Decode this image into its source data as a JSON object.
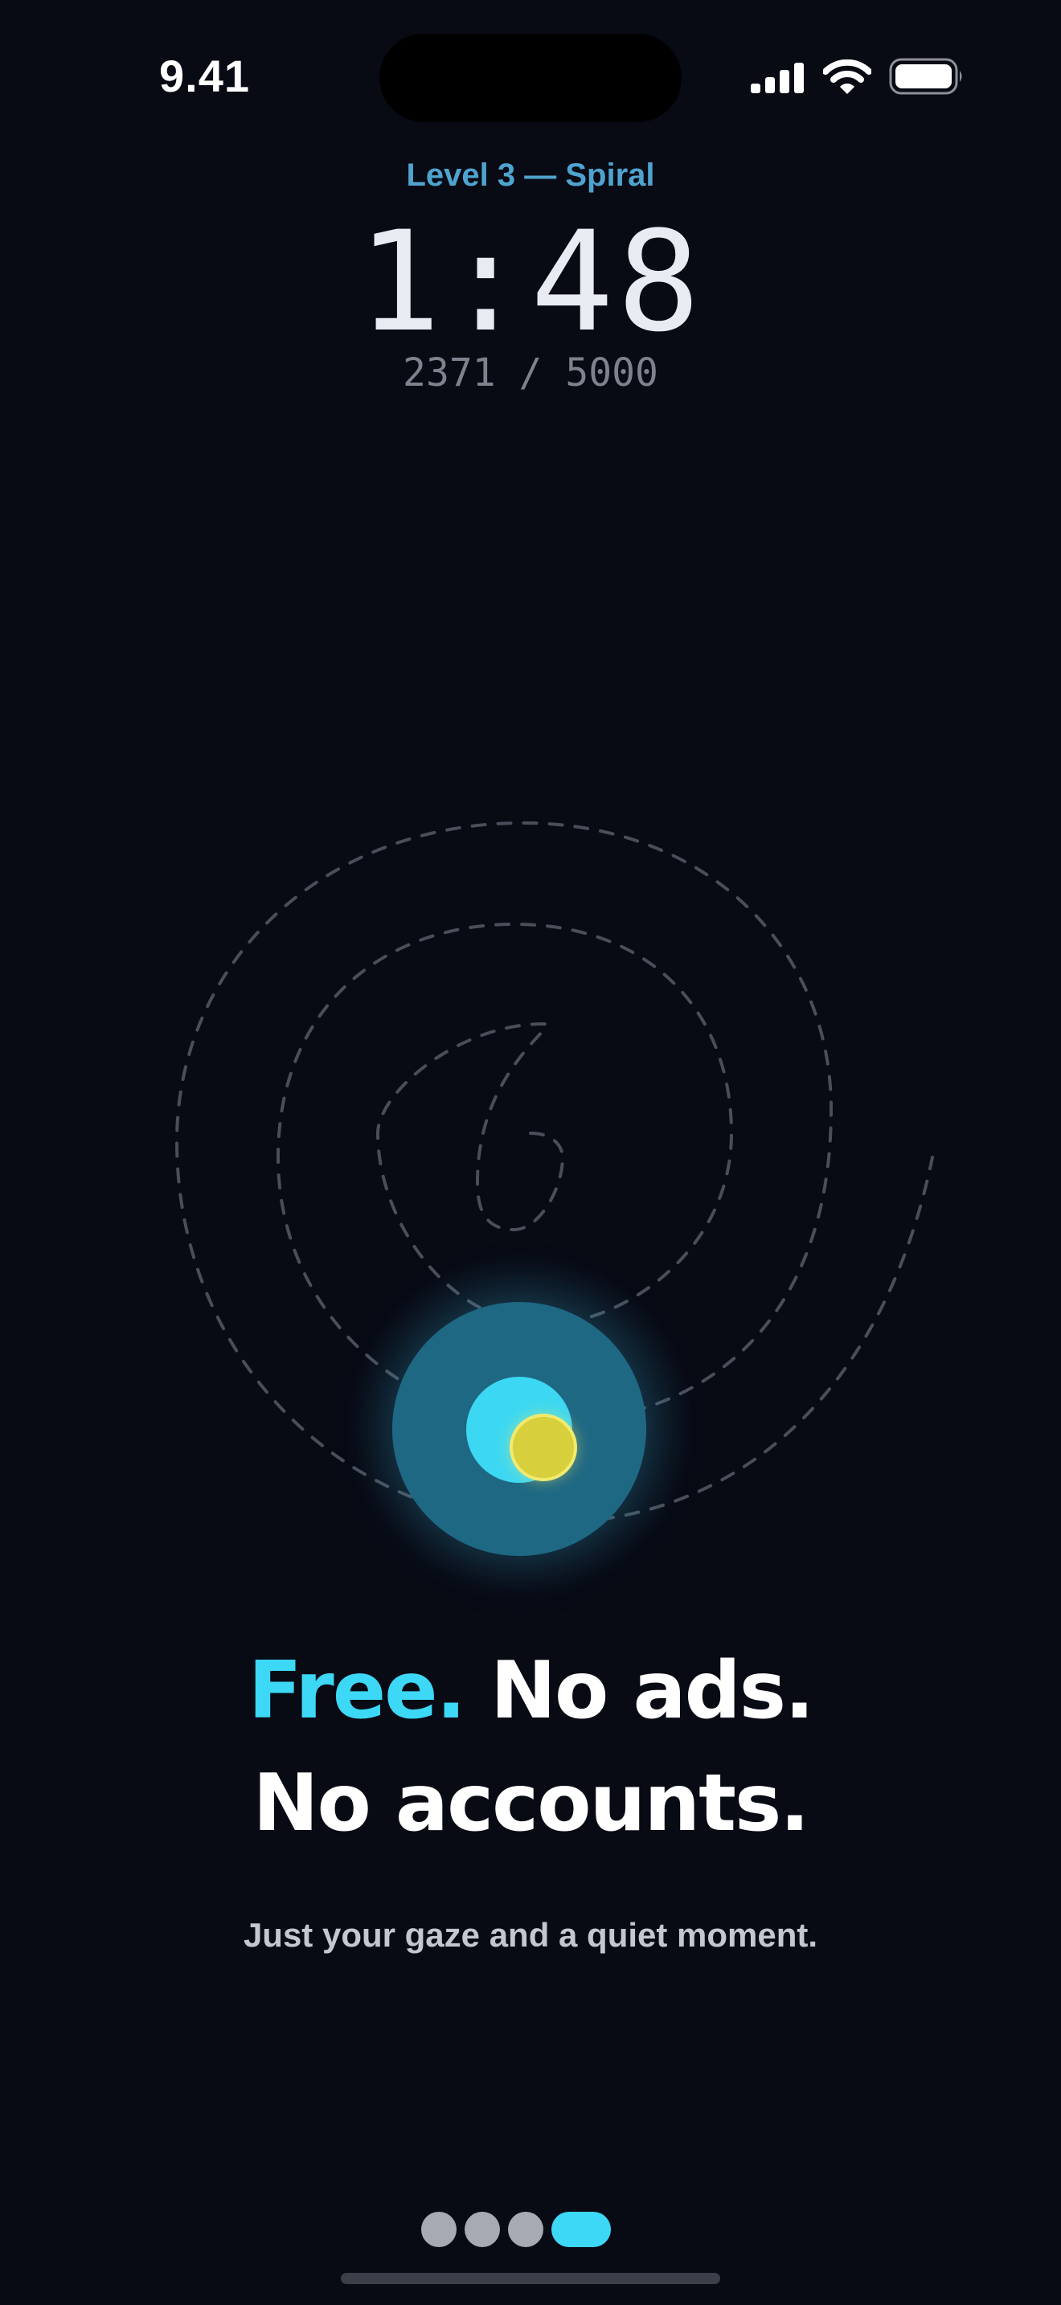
{
  "status_bar": {
    "time": "9.41",
    "icons": [
      "cellular-signal-icon",
      "wifi-icon",
      "battery-icon"
    ]
  },
  "game": {
    "level_label": "Level 3 — Spiral",
    "timer": "1:48",
    "score": "2371 / 5000"
  },
  "onboarding": {
    "headline_accent": "Free.",
    "headline_rest": " No ads.",
    "headline_line2": "No accounts.",
    "subtitle": "Just your gaze and a quiet moment."
  },
  "pager": {
    "total_pages": 4,
    "current_page": 4
  },
  "colors": {
    "background": "#080a14",
    "accent": "#3cd8f6",
    "level_label": "#4fa3cf",
    "target_ring": "#1e6884",
    "gaze_dot": "#d8cf3c"
  }
}
